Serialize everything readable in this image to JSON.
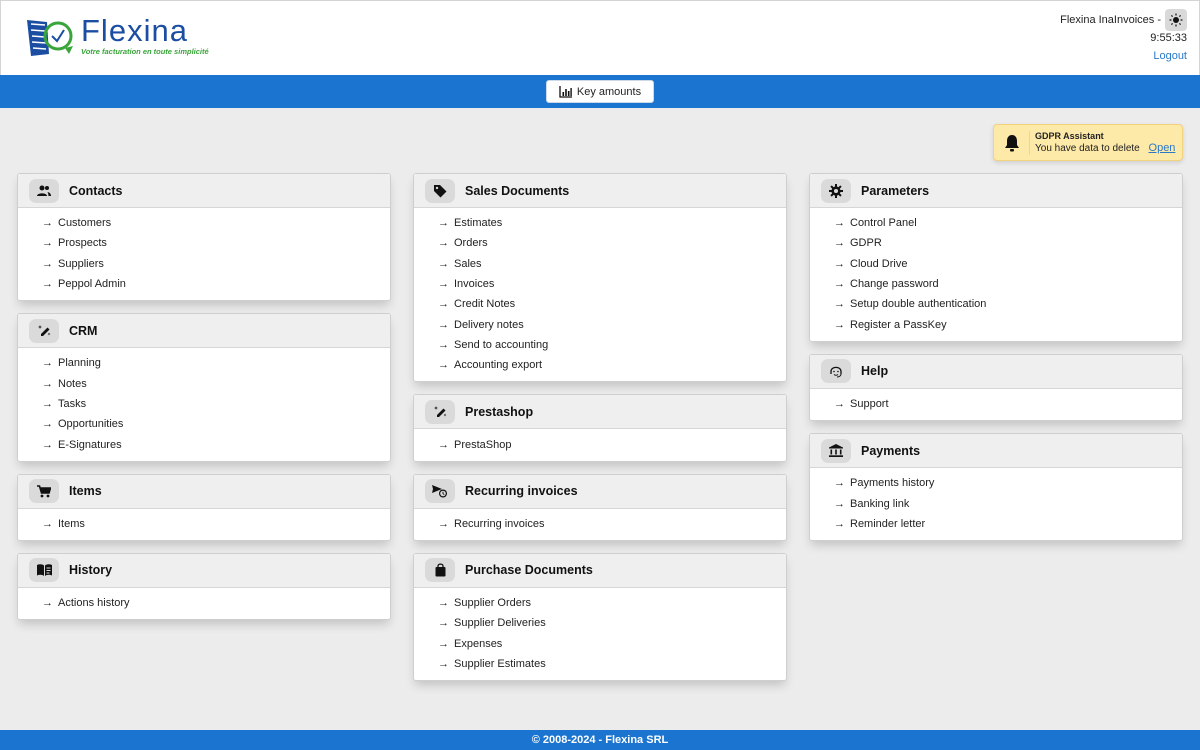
{
  "header": {
    "logo_name": "Flexina",
    "logo_tagline": "Votre facturation en toute simplicité",
    "user_label": "Flexina InaInvoices -",
    "clock": "9:55:33",
    "logout_label": "Logout",
    "theme_icon": "sun-icon"
  },
  "toolbar": {
    "key_amounts_label": "Key amounts",
    "key_amounts_icon": "bar-chart-icon"
  },
  "gdpr": {
    "title": "GDPR Assistant",
    "message": "You have data to delete",
    "open_label": "Open",
    "icon": "bell-icon"
  },
  "columns": [
    [
      {
        "title": "Contacts",
        "icon": "people-icon",
        "links": [
          "Customers",
          "Prospects",
          "Suppliers",
          "Peppol Admin"
        ]
      },
      {
        "title": "CRM",
        "icon": "edit-sparkle-icon",
        "links": [
          "Planning",
          "Notes",
          "Tasks",
          "Opportunities",
          "E-Signatures"
        ]
      },
      {
        "title": "Items",
        "icon": "cart-icon",
        "links": [
          "Items"
        ]
      },
      {
        "title": "History",
        "icon": "book-icon",
        "links": [
          "Actions history"
        ]
      }
    ],
    [
      {
        "title": "Sales Documents",
        "icon": "tag-icon",
        "links": [
          "Estimates",
          "Orders",
          "Sales",
          "Invoices",
          "Credit Notes",
          "Delivery notes",
          "Send to accounting",
          "Accounting export"
        ]
      },
      {
        "title": "Prestashop",
        "icon": "edit-sparkle-icon",
        "links": [
          "PrestaShop"
        ]
      },
      {
        "title": "Recurring invoices",
        "icon": "send-clock-icon",
        "links": [
          "Recurring invoices"
        ]
      },
      {
        "title": "Purchase Documents",
        "icon": "shopping-bag-icon",
        "links": [
          "Supplier Orders",
          "Supplier Deliveries",
          "Expenses",
          "Supplier Estimates"
        ]
      }
    ],
    [
      {
        "title": "Parameters",
        "icon": "gear-icon",
        "links": [
          "Control Panel",
          "GDPR",
          "Cloud Drive",
          "Change password",
          "Setup double authentication",
          "Register a PassKey"
        ]
      },
      {
        "title": "Help",
        "icon": "headset-icon",
        "links": [
          "Support"
        ]
      },
      {
        "title": "Payments",
        "icon": "bank-icon",
        "links": [
          "Payments history",
          "Banking link",
          "Reminder letter"
        ]
      }
    ]
  ],
  "footer": {
    "text": "© 2008-2024 - Flexina SRL"
  }
}
